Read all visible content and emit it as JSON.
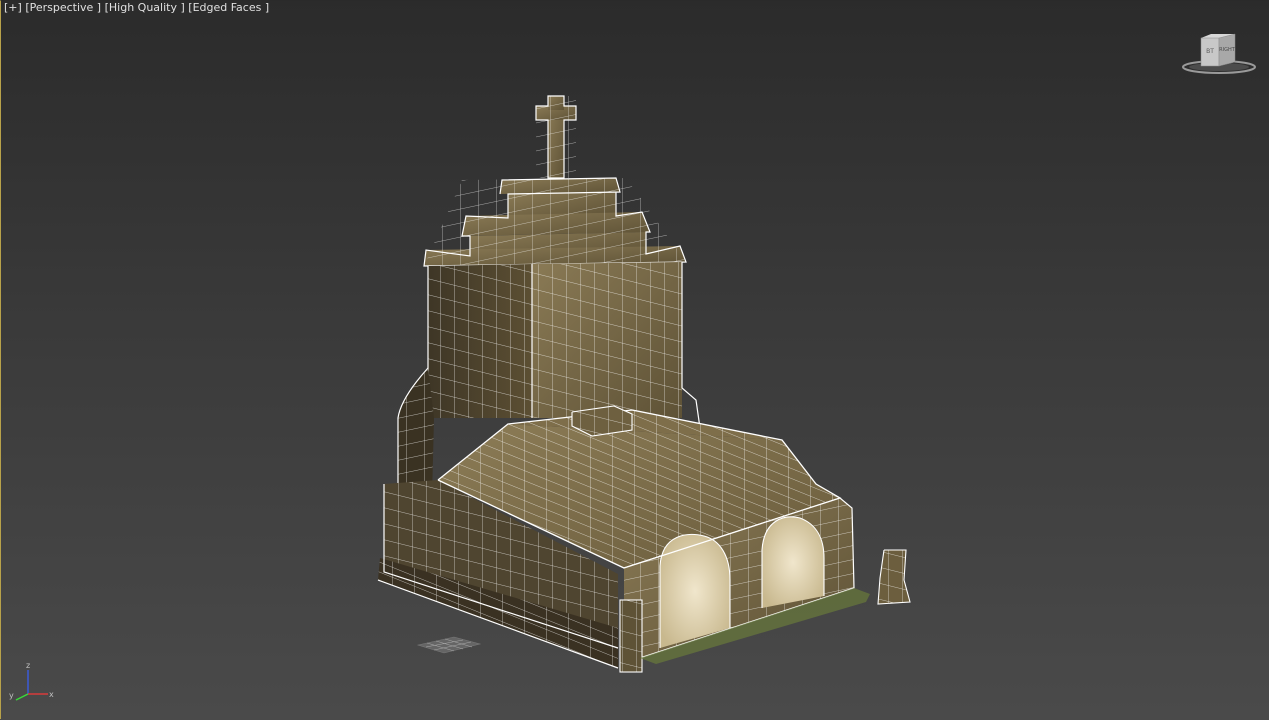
{
  "viewport": {
    "labels": {
      "plus": "[+]",
      "view": "[Perspective ]",
      "quality": "[High Quality ]",
      "shading": "[Edged Faces ]"
    },
    "viewcube": {
      "front_label": "BT",
      "right_label": "RIGHT"
    },
    "axis_gizmo": {
      "z": "z",
      "y": "y",
      "x": "x"
    },
    "colors": {
      "background_top": "#2b2b2b",
      "background_bottom": "#4a4a4a",
      "active_border": "#b8a24a",
      "wireframe": "#ffffff",
      "stone": "#7a6a45",
      "arch_fill": "#e8dcc0"
    }
  }
}
